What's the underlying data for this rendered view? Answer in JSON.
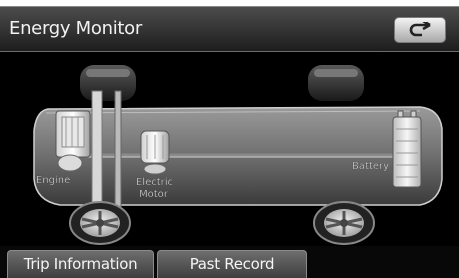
{
  "header": {
    "title": "Energy Monitor"
  },
  "back_button": {
    "icon": "back-arrow-icon"
  },
  "diagram": {
    "engine_label": "Engine",
    "motor_label_line1": "Electric",
    "motor_label_line2": "Motor",
    "battery_label": "Battery"
  },
  "tabs": [
    {
      "label": "Trip Information"
    },
    {
      "label": "Past Record"
    }
  ]
}
